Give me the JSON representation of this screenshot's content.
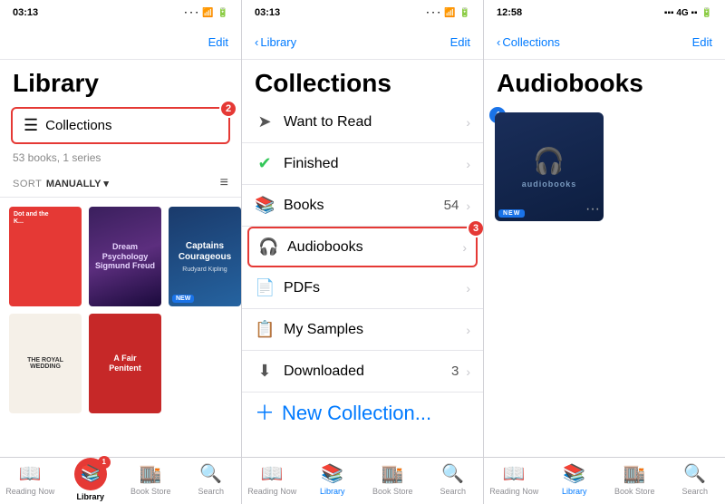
{
  "left": {
    "status_time": "03:13",
    "status_dots": "···",
    "nav_title": "",
    "nav_edit": "Edit",
    "page_title": "Library",
    "collections_label": "Collections",
    "collections_badge": "2",
    "library_meta": "53 books, 1 series",
    "sort_label": "SORT",
    "sort_value": "MANUALLY ▾",
    "books": [
      {
        "title": "Dot and the ...",
        "type": "dot"
      },
      {
        "title": "Dream Psychology Sigmund Freud",
        "type": "dream"
      },
      {
        "title": "Captains Courageous",
        "subtitle": "Rudyard Kipling",
        "type": "captains"
      }
    ],
    "books2": [
      {
        "title": "THE ROYAL WEDDING",
        "type": "royal"
      },
      {
        "title": "A Fair Penitent",
        "type": "fair"
      }
    ],
    "tab_bar": [
      {
        "label": "Reading Now",
        "icon": "📖",
        "active": false
      },
      {
        "label": "Library",
        "icon": "📚",
        "active": true,
        "circle": true
      },
      {
        "label": "Book Store",
        "icon": "🏬",
        "active": false
      },
      {
        "label": "Search",
        "icon": "🔍",
        "active": false
      }
    ]
  },
  "mid": {
    "status_time": "03:13",
    "status_dots": "···",
    "nav_back": "Library",
    "nav_edit": "Edit",
    "page_title": "Collections",
    "badge": "3",
    "items": [
      {
        "id": "want-read",
        "icon": "➡️",
        "label": "Want to Read",
        "count": "",
        "highlighted": false
      },
      {
        "id": "finished",
        "icon": "✅",
        "label": "Finished",
        "count": "",
        "highlighted": false
      },
      {
        "id": "books",
        "icon": "📚",
        "label": "Books",
        "count": "54",
        "highlighted": false
      },
      {
        "id": "audiobooks",
        "icon": "🎧",
        "label": "Audiobooks",
        "count": "",
        "highlighted": true
      },
      {
        "id": "pdfs",
        "icon": "📄",
        "label": "PDFs",
        "count": "",
        "highlighted": false
      },
      {
        "id": "my-samples",
        "icon": "📋",
        "label": "My Samples",
        "count": "",
        "highlighted": false
      },
      {
        "id": "downloaded",
        "icon": "⬇️",
        "label": "Downloaded",
        "count": "3",
        "highlighted": false
      }
    ],
    "new_collection": "New Collection...",
    "tab_bar": [
      {
        "label": "Reading Now",
        "icon": "📖",
        "active": false
      },
      {
        "label": "Library",
        "icon": "📚",
        "active": true
      },
      {
        "label": "Book Store",
        "icon": "🏬",
        "active": false
      },
      {
        "label": "Search",
        "icon": "🔍",
        "active": false
      }
    ]
  },
  "right": {
    "status_time": "12:58",
    "status_signal": "▪▪▪ 4G ▪▪",
    "nav_back": "Collections",
    "nav_edit": "Edit",
    "page_title": "Audiobooks",
    "badge": "4",
    "audiobook": {
      "label": "audiobooks",
      "new_badge": "NEW"
    },
    "tab_bar": [
      {
        "label": "Reading Now",
        "icon": "📖",
        "active": false
      },
      {
        "label": "Library",
        "icon": "📚",
        "active": true
      },
      {
        "label": "Book Store",
        "icon": "🏬",
        "active": false
      },
      {
        "label": "Search",
        "icon": "🔍",
        "active": false
      }
    ]
  }
}
